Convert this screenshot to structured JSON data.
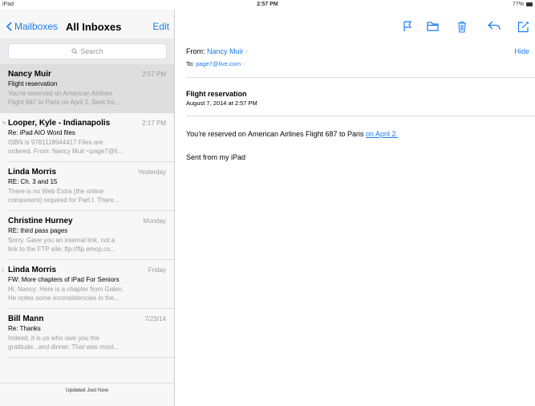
{
  "status": {
    "device": "iPad",
    "time": "2:57 PM",
    "battery": "77%"
  },
  "colors": {
    "accent": "#1a7cf2"
  },
  "mail_list": {
    "back_label": "Mailboxes",
    "title": "All Inboxes",
    "edit_label": "Edit",
    "search_placeholder": "Search",
    "updated_text": "Updated Just Now",
    "items": [
      {
        "sender": "Nancy Muir",
        "time": "2:57 PM",
        "subject": "Flight reservation",
        "preview1": "You're reserved on American Airlines",
        "preview2": "Flight 687 to Paris on April 2. Sent fro..."
      },
      {
        "sender": "Looper, Kyle - Indianapolis",
        "time": "2:17 PM",
        "subject": "Re: iPad AIO Word files",
        "preview1": "ISBN is 9781118944417 Files are",
        "preview2": "ordered. From: Nancy Muir <page7@li..."
      },
      {
        "sender": "Linda Morris",
        "time": "Yesterday",
        "subject": "RE: Ch. 3 and 15",
        "preview1": "There is no Web Extra (the online",
        "preview2": "component) required for Part I. There..."
      },
      {
        "sender": "Christine Hurney",
        "time": "Monday",
        "subject": "RE: third pass pages",
        "preview1": "Sorry. Gave you an internal link, not a",
        "preview2": "link to the FTP site: ftp://ftp.emcp.co..."
      },
      {
        "sender": "Linda Morris",
        "time": "Friday",
        "subject": "FW: More chapters of iPad For Seniors",
        "preview1": "Hi, Nancy: Here is a chapter from Galen.",
        "preview2": "He notes some inconsistencies in the..."
      },
      {
        "sender": "Bill Mann",
        "time": "7/23/14",
        "subject": "Re: Thanks",
        "preview1": "Indeed, it is us who owe you the",
        "preview2": "gratitude...and dinner. That was most..."
      }
    ]
  },
  "message": {
    "from_label": "From:",
    "from_name": "Nancy Muir",
    "hide_label": "Hide",
    "to_label": "To:",
    "to_address": "page7@live.com",
    "subject": "Flight reservation",
    "date": "August 7, 2014 at 2:57 PM",
    "body_text": "You're reserved on American Airlines Flight 687 to Paris ",
    "body_link": "on April 2.",
    "signature": "Sent from my iPad"
  }
}
